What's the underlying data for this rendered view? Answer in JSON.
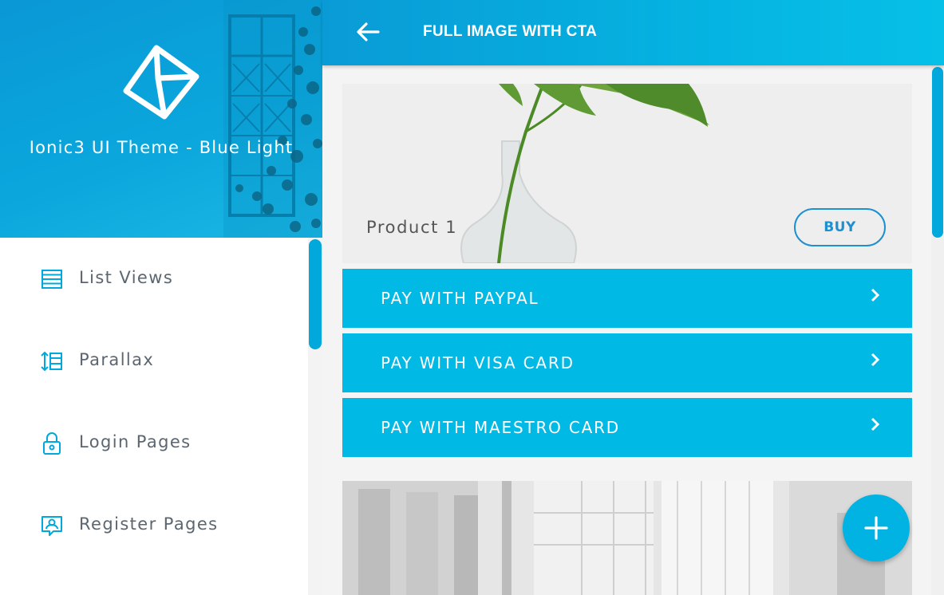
{
  "sidemenu": {
    "title": "Ionic3 UI Theme - Blue Light",
    "logo_icon": "cube-logo-icon",
    "items": [
      {
        "label": "List Views",
        "icon": "list-icon"
      },
      {
        "label": "Parallax",
        "icon": "parallax-icon"
      },
      {
        "label": "Login Pages",
        "icon": "lock-icon"
      },
      {
        "label": "Register Pages",
        "icon": "register-icon"
      }
    ]
  },
  "toolbar": {
    "title": "FULL IMAGE WITH CTA",
    "back_icon": "arrow-back-icon"
  },
  "content": {
    "card": {
      "name": "Product 1",
      "buy_label": "BUY"
    },
    "payments": [
      {
        "label": "PAY WITH PAYPAL",
        "icon": "chevron-right-icon"
      },
      {
        "label": "PAY WITH VISA CARD",
        "icon": "chevron-right-icon"
      },
      {
        "label": "PAY WITH MAESTRO CARD",
        "icon": "chevron-right-icon"
      }
    ]
  },
  "fab": {
    "icon": "plus-icon"
  },
  "colors": {
    "accent": "#00b9e4",
    "header_blue": "#0a98d6",
    "buy_outline": "#1e8fcf",
    "menu_text": "#5b6670",
    "scroll_thumb": "#00a8db"
  }
}
